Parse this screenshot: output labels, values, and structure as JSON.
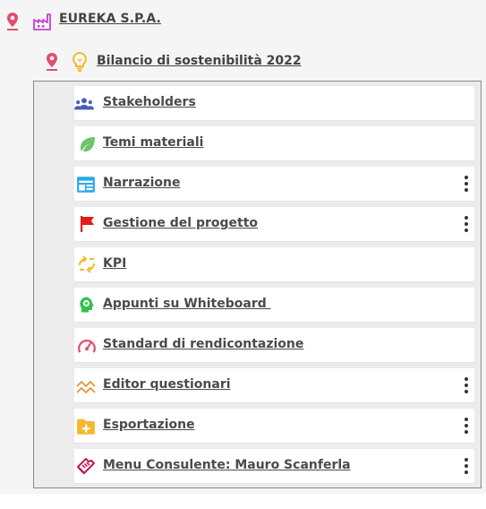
{
  "company": {
    "name": "EUREKA S.P.A.",
    "pin_icon": "map-pin-icon",
    "icon": "factory-icon"
  },
  "report": {
    "title": "Bilancio di sostenibilità 2022",
    "pin_icon": "map-pin-icon",
    "icon": "lightbulb-icon"
  },
  "menu": {
    "items": [
      {
        "label": "Stakeholders",
        "icon": "people-group-icon",
        "has_menu": false
      },
      {
        "label": "Temi materiali",
        "icon": "leaf-icon",
        "has_menu": false
      },
      {
        "label": "Narrazione",
        "icon": "layout-icon",
        "has_menu": true
      },
      {
        "label": "Gestione del progetto",
        "icon": "flag-icon",
        "has_menu": true
      },
      {
        "label": "KPI",
        "icon": "kpi-icon",
        "has_menu": false
      },
      {
        "label": "Appunti su Whiteboard ",
        "icon": "head-brain-icon",
        "has_menu": false
      },
      {
        "label": "Standard di rendicontazione",
        "icon": "gauge-icon",
        "has_menu": false
      },
      {
        "label": "Editor questionari",
        "icon": "chart-lines-icon",
        "has_menu": true
      },
      {
        "label": "Esportazione",
        "icon": "folder-plus-icon",
        "has_menu": true
      },
      {
        "label": "Menu Consulente: Mauro Scanferla",
        "icon": "handshake-icon",
        "has_menu": true
      }
    ]
  },
  "colors": {
    "pin": "#e0506e",
    "factory": "#c23fd6",
    "bulb": "#f5b82e",
    "stakeholders": "#4b5bbd",
    "leaf": "#6cc46b",
    "layout": "#29a9e8",
    "flag": "#e31b1b",
    "kpi": "#f5b82e",
    "brain": "#2ec24a",
    "gauge": "#e0506e",
    "lines": "#e8953a",
    "folder": "#f5b82e",
    "handshake": "#c2185b"
  }
}
